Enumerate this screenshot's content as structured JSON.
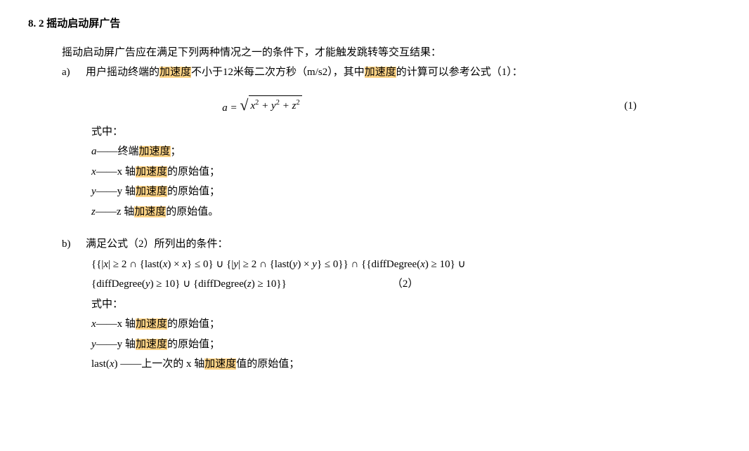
{
  "section": {
    "number": "8. 2",
    "title": "摇动启动屏广告"
  },
  "intro": {
    "pre": "摇动启动屏广告应在满足下列两种情况之一的条件下，才能触发跳转等交互结果："
  },
  "a": {
    "label": "a)",
    "t1": "用户摇动终端的",
    "hl1": "加速度",
    "t2": "不小于12米每二次方秒（m/s2），其中",
    "hl2": "加速度",
    "t3": "的计算可以参考公式（1）："
  },
  "formula1": {
    "lhs": "a",
    "eq": " = ",
    "rhs_x": "x",
    "rhs_y": "y",
    "rhs_z": "z",
    "sq": "2",
    "plus": " + ",
    "num": "(1)"
  },
  "where1": {
    "title": "式中：",
    "a": {
      "sym": "a",
      "dash": "——",
      "pre": "终端",
      "hl": "加速度",
      "post": "；"
    },
    "x": {
      "sym": "x",
      "dash": "——",
      "pre": "x 轴",
      "hl": "加速度",
      "post": "的原始值；"
    },
    "y": {
      "sym": "y",
      "dash": "——",
      "pre": "y 轴",
      "hl": "加速度",
      "post": "的原始值；"
    },
    "z": {
      "sym": "z",
      "dash": "——",
      "pre": "z 轴",
      "hl": "加速度",
      "post": "的原始值。"
    }
  },
  "b": {
    "label": "b)",
    "text": "满足公式（2）所列出的条件："
  },
  "formula2": {
    "line1": "{{|x| ≥ 2 ∩ {last(x) × x} ≤ 0} ∪ {|y| ≥ 2 ∩ {last(y) × y} ≤ 0}} ∩ {{diffDegree(x) ≥ 10} ∪",
    "line2": "{diffDegree(y) ≥ 10} ∪ {diffDegree(z) ≥ 10}}",
    "num": "（2）"
  },
  "where2": {
    "title": "式中：",
    "x": {
      "sym": "x",
      "dash": "——",
      "pre": "x 轴",
      "hl": "加速度",
      "post": "的原始值；"
    },
    "y": {
      "sym": "y",
      "dash": "——",
      "pre": "y 轴",
      "hl": "加速度",
      "post": "的原始值；"
    },
    "lastx": {
      "sym": "last(x) ",
      "dash": "——",
      "pre": "上一次的 x 轴",
      "hl": "加速度",
      "post": "值的原始值；"
    }
  }
}
